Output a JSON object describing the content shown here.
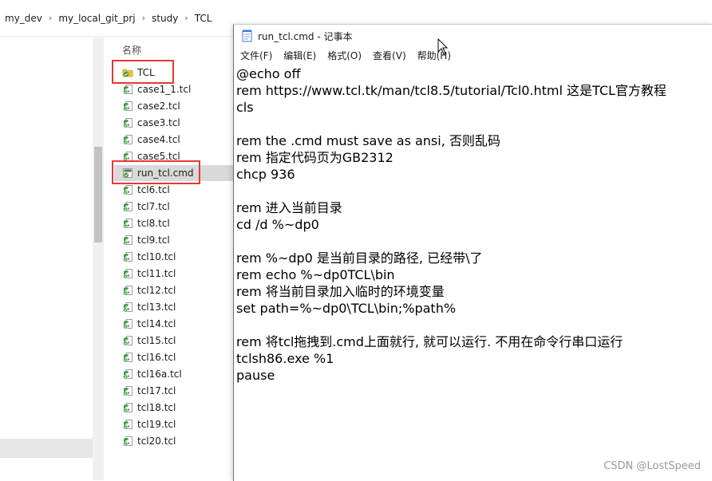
{
  "breadcrumb": [
    "my_dev",
    "my_local_git_prj",
    "study",
    "TCL"
  ],
  "explorer": {
    "column_header": "名称",
    "files": [
      {
        "name": "TCL",
        "type": "folder"
      },
      {
        "name": "case1_1.tcl",
        "type": "tcl"
      },
      {
        "name": "case2.tcl",
        "type": "tcl"
      },
      {
        "name": "case3.tcl",
        "type": "tcl"
      },
      {
        "name": "case4.tcl",
        "type": "tcl"
      },
      {
        "name": "case5.tcl",
        "type": "tcl"
      },
      {
        "name": "run_tcl.cmd",
        "type": "cmd",
        "selected": true
      },
      {
        "name": "tcl6.tcl",
        "type": "tcl"
      },
      {
        "name": "tcl7.tcl",
        "type": "tcl"
      },
      {
        "name": "tcl8.tcl",
        "type": "tcl"
      },
      {
        "name": "tcl9.tcl",
        "type": "tcl"
      },
      {
        "name": "tcl10.tcl",
        "type": "tcl"
      },
      {
        "name": "tcl11.tcl",
        "type": "tcl"
      },
      {
        "name": "tcl12.tcl",
        "type": "tcl"
      },
      {
        "name": "tcl13.tcl",
        "type": "tcl"
      },
      {
        "name": "tcl14.tcl",
        "type": "tcl"
      },
      {
        "name": "tcl15.tcl",
        "type": "tcl"
      },
      {
        "name": "tcl16.tcl",
        "type": "tcl"
      },
      {
        "name": "tcl16a.tcl",
        "type": "tcl"
      },
      {
        "name": "tcl17.tcl",
        "type": "tcl"
      },
      {
        "name": "tcl18.tcl",
        "type": "tcl"
      },
      {
        "name": "tcl19.tcl",
        "type": "tcl"
      },
      {
        "name": "tcl20.tcl",
        "type": "tcl"
      }
    ]
  },
  "notepad": {
    "title": "run_tcl.cmd - 记事本",
    "menu": [
      "文件(F)",
      "编辑(E)",
      "格式(O)",
      "查看(V)",
      "帮助(H)"
    ],
    "lines": [
      "@echo off",
      "rem https://www.tcl.tk/man/tcl8.5/tutorial/Tcl0.html 这是TCL官方教程",
      "cls",
      "",
      "rem the .cmd must save as ansi, 否则乱码",
      "rem 指定代码页为GB2312",
      "chcp 936",
      "",
      "rem 进入当前目录",
      "cd /d %~dp0",
      "",
      "rem %~dp0 是当前目录的路径, 已经带\\了",
      "rem echo %~dp0TCL\\bin",
      "rem 将当前目录加入临时的环境变量",
      "set path=%~dp0\\TCL\\bin;%path%",
      "",
      "rem 将tcl拖拽到.cmd上面就行, 就可以运行. 不用在命令行串口运行",
      "tclsh86.exe %1",
      "pause"
    ]
  },
  "watermark": "CSDN @LostSpeed",
  "colors": {
    "highlight_box": "#e53935",
    "selected_row": "#d9d9d9",
    "tcl_icon_green": "#3a9a3a",
    "folder_yellow": "#e8c24a"
  }
}
